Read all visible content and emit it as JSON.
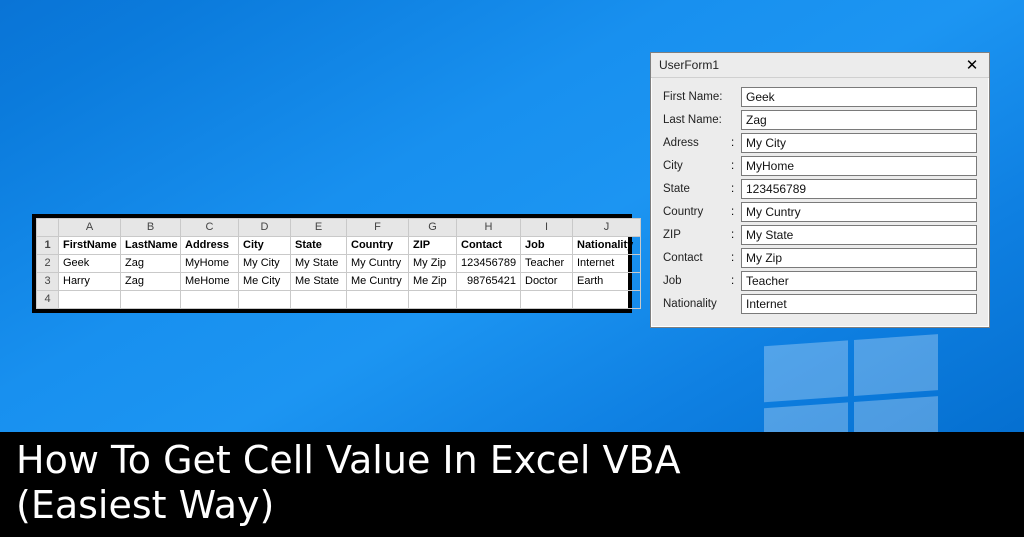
{
  "spreadsheet": {
    "columns": [
      "A",
      "B",
      "C",
      "D",
      "E",
      "F",
      "G",
      "H",
      "I",
      "J"
    ],
    "row_numbers": [
      "1",
      "2",
      "3",
      "4"
    ],
    "header_row": [
      "FirstName",
      "LastName",
      "Address",
      "City",
      "State",
      "Country",
      "ZIP",
      "Contact",
      "Job",
      "Nationality"
    ],
    "rows": [
      [
        "Geek",
        "Zag",
        "MyHome",
        "My City",
        "My State",
        "My Cuntry",
        "My Zip",
        "123456789",
        "Teacher",
        "Internet"
      ],
      [
        "Harry",
        "Zag",
        "MeHome",
        "Me City",
        "Me State",
        "Me Cuntry",
        "Me Zip",
        "98765421",
        "Doctor",
        "Earth"
      ]
    ]
  },
  "userform": {
    "title": "UserForm1",
    "fields": [
      {
        "label": "First Name:",
        "colon": "",
        "value": "Geek"
      },
      {
        "label": "Last Name:",
        "colon": "",
        "value": "Zag"
      },
      {
        "label": "Adress",
        "colon": ":",
        "value": "My City"
      },
      {
        "label": "City",
        "colon": ":",
        "value": "MyHome"
      },
      {
        "label": "State",
        "colon": ":",
        "value": "123456789"
      },
      {
        "label": "Country",
        "colon": ":",
        "value": "My Cuntry"
      },
      {
        "label": "ZIP",
        "colon": ":",
        "value": "My State"
      },
      {
        "label": "Contact",
        "colon": ":",
        "value": "My Zip"
      },
      {
        "label": "Job",
        "colon": ":",
        "value": "Teacher"
      },
      {
        "label": "Nationality",
        "colon": "",
        "value": "Internet"
      }
    ]
  },
  "caption": {
    "line1": "How To Get Cell Value In Excel VBA",
    "line2": "(Easiest Way)"
  }
}
